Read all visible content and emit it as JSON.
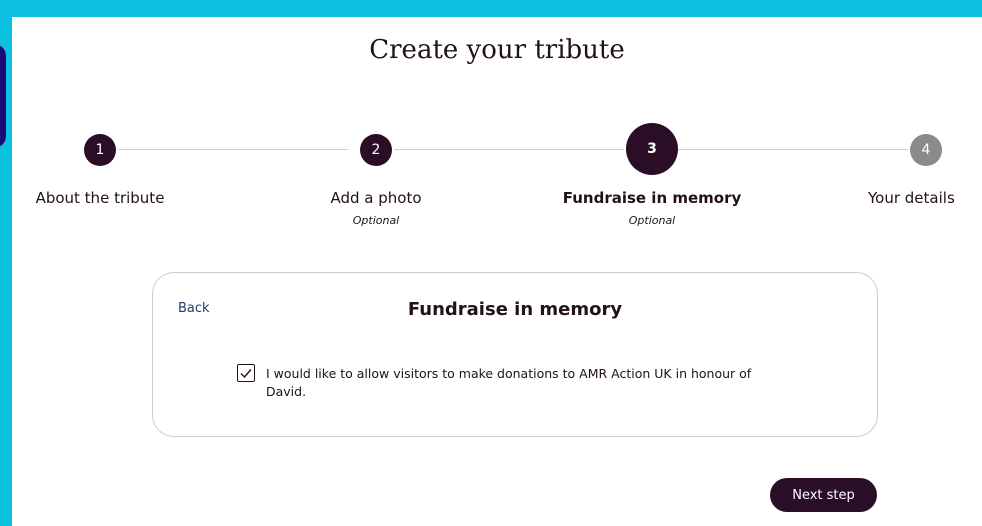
{
  "page": {
    "title": "Create your tribute"
  },
  "stepper": {
    "steps": [
      {
        "number": "1",
        "label": "About the tribute",
        "optional": "",
        "state": "done"
      },
      {
        "number": "2",
        "label": "Add a photo",
        "optional": "Optional",
        "state": "done"
      },
      {
        "number": "3",
        "label": "Fundraise in memory",
        "optional": "Optional",
        "state": "current"
      },
      {
        "number": "4",
        "label": "Your details",
        "optional": "",
        "state": "pending"
      }
    ]
  },
  "card": {
    "back_label": "Back",
    "title": "Fundraise in memory",
    "donation_checkbox": {
      "checked": true,
      "label": "I would like to allow visitors to make donations to AMR Action UK in honour of David."
    }
  },
  "footer": {
    "next_label": "Next step"
  },
  "colors": {
    "background": "#0cc0df",
    "primary": "#2a0d26",
    "pending_step": "#8a8a8a",
    "link": "#1f3a6b"
  }
}
